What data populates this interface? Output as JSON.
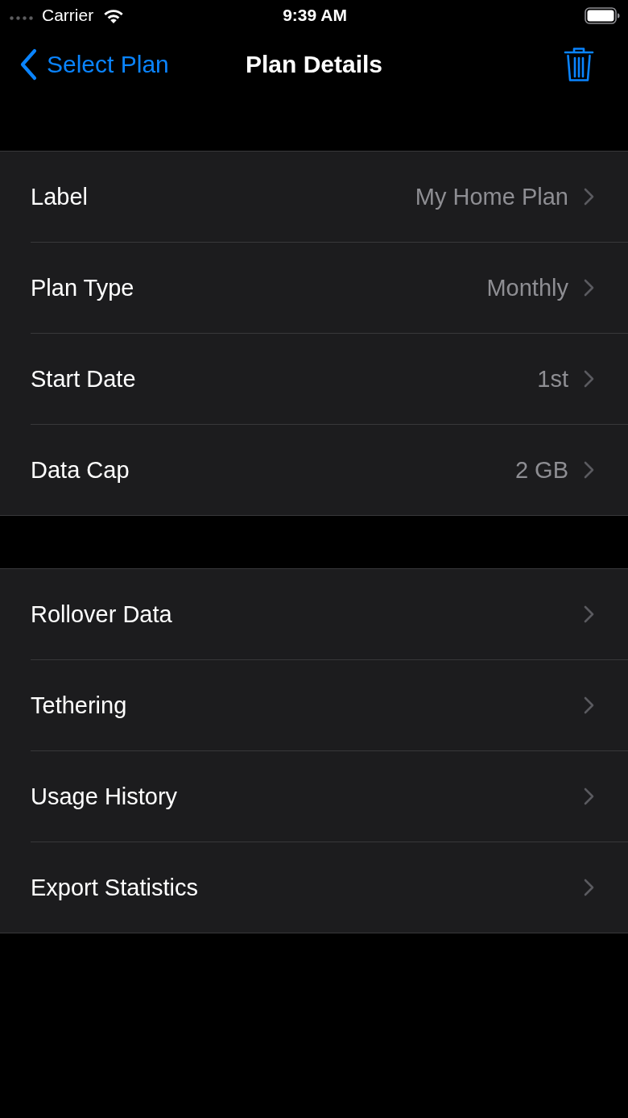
{
  "status_bar": {
    "carrier": "Carrier",
    "time": "9:39 AM"
  },
  "nav_bar": {
    "back_label": "Select Plan",
    "title": "Plan Details"
  },
  "sections": [
    {
      "rows": [
        {
          "label": "Label",
          "value": "My Home Plan"
        },
        {
          "label": "Plan Type",
          "value": "Monthly"
        },
        {
          "label": "Start Date",
          "value": "1st"
        },
        {
          "label": "Data Cap",
          "value": "2 GB"
        }
      ]
    },
    {
      "rows": [
        {
          "label": "Rollover Data"
        },
        {
          "label": "Tethering"
        },
        {
          "label": "Usage History"
        },
        {
          "label": "Export Statistics"
        }
      ]
    }
  ]
}
